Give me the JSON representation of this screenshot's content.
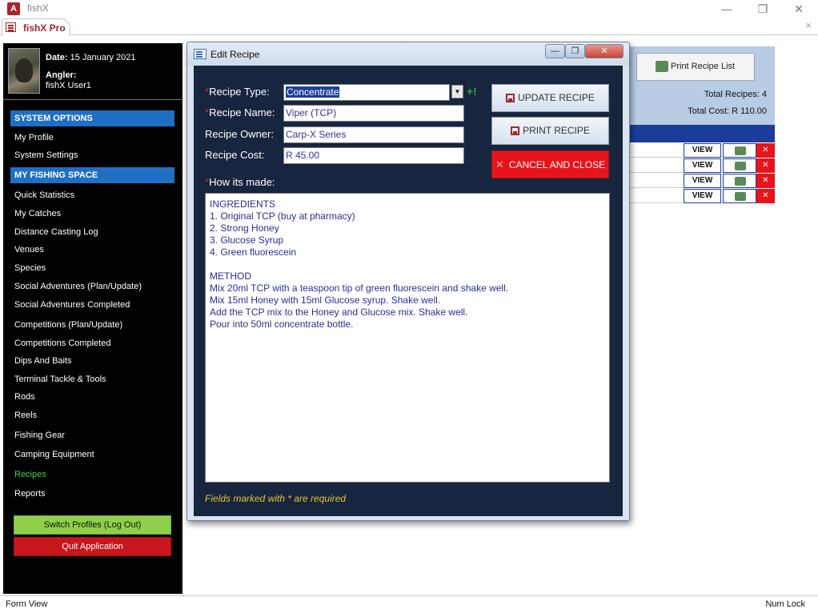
{
  "app": {
    "icon_letter": "A",
    "title": "fishX",
    "controls": {
      "minimize": "—",
      "restore": "❐",
      "close": "✕"
    }
  },
  "tab": {
    "label": "fishX Pro",
    "close": "×"
  },
  "sidebar": {
    "date_label": "Date:",
    "date_value": "15 January 2021",
    "angler_label": "Angler:",
    "angler_name": "fishX User1",
    "section_system": "SYSTEM OPTIONS",
    "system_items": [
      "My Profile",
      "System Settings"
    ],
    "section_fishing": "MY FISHING SPACE",
    "fishing_items": [
      "Quick Statistics",
      "My Catches",
      "Distance Casting Log",
      "Venues",
      "Species",
      "Social Adventures (Plan/Update)",
      "Social Adventures Completed",
      "Competitions (Plan/Update)",
      "Competitions Completed",
      "Dips And Baits",
      "Terminal Tackle & Tools",
      "Rods",
      "Reels",
      "Fishing Gear",
      "Camping Equipment",
      "Recipes",
      "Reports"
    ],
    "active_item": "Recipes",
    "switch_button": "Switch Profiles (Log Out)",
    "quit_button": "Quit Application"
  },
  "background_form": {
    "print_list_button": "Print Recipe List",
    "total_recipes": "Total Recipes: 4",
    "total_cost": "Total Cost: R 110.00",
    "row_view_label": "VIEW",
    "row_delete_label": "✕",
    "row_count_visible": 4
  },
  "dialog": {
    "title": "Edit Recipe",
    "fields": {
      "recipe_type_label": "Recipe Type:",
      "recipe_type_value": "Concentrate",
      "recipe_name_label": "Recipe Name:",
      "recipe_name_value": "Viper (TCP)",
      "recipe_owner_label": "Recipe Owner:",
      "recipe_owner_value": "Carp-X Series",
      "recipe_cost_label": "Recipe Cost:",
      "recipe_cost_value": "R 45.00",
      "how_made_label": "How its made:"
    },
    "how_made_text": "INGREDIENTS\n1. Original TCP (buy at pharmacy)\n2. Strong Honey\n3. Glucose Syrup\n4. Green fluorescein\n\nMETHOD\nMix 20ml TCP with a teaspoon tip of green fluorescein and shake well.\nMix 15ml Honey with 15ml Glucose syrup. Shake well.\nAdd the TCP mix to the Honey and Glucose mix. Shake well.\nPour into 50ml concentrate bottle.",
    "buttons": {
      "update": "UPDATE RECIPE",
      "print": "PRINT RECIPE",
      "cancel": "CANCEL AND CLOSE"
    },
    "add_type_icon": "+!",
    "footnote": "Fields marked with * are required"
  },
  "status": {
    "left": "Form View",
    "right": "Num Lock"
  }
}
